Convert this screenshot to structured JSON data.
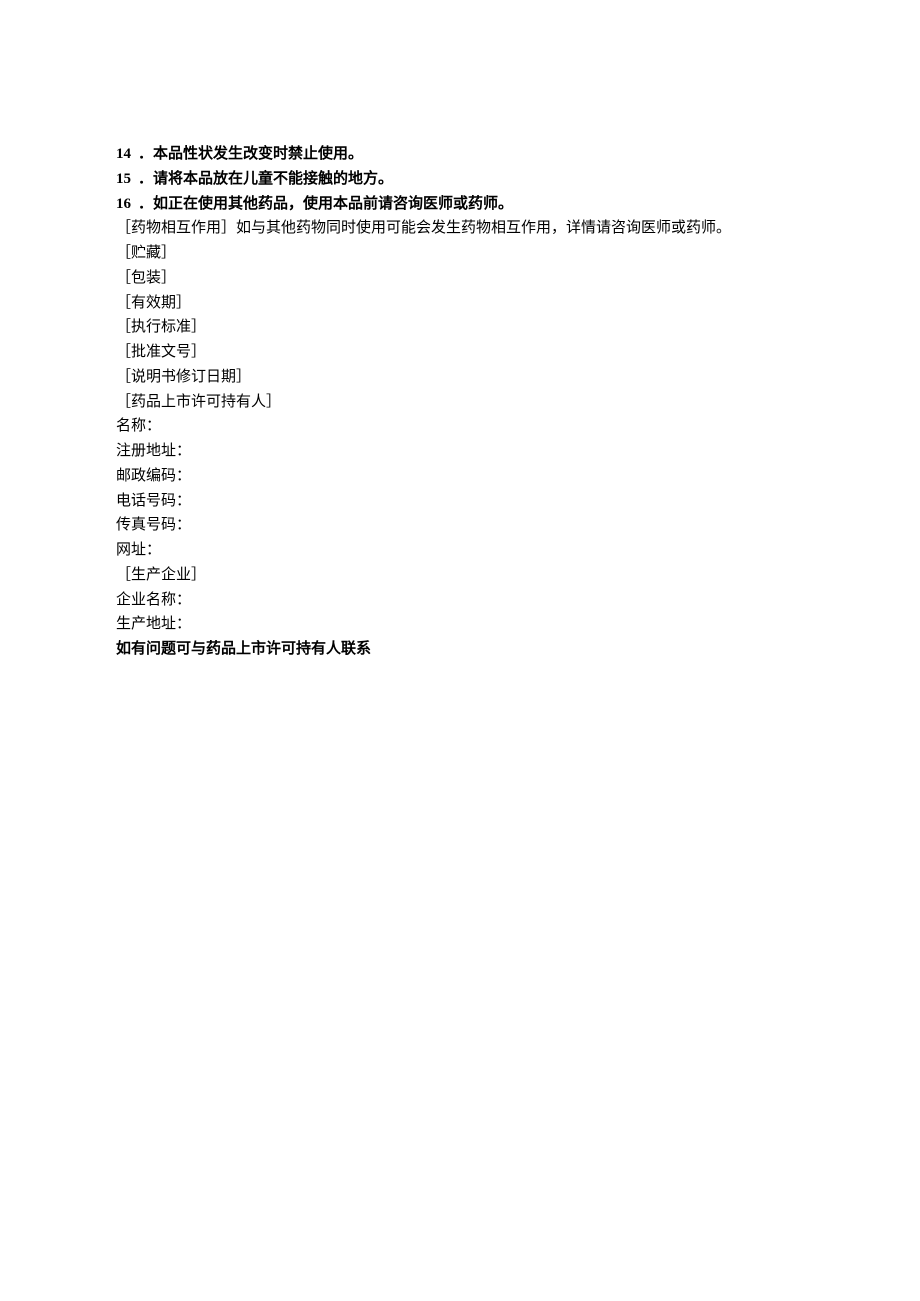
{
  "items": [
    {
      "num": "14",
      "text": "．本品性状发生改变时禁止使用。"
    },
    {
      "num": "15",
      "text": "．请将本品放在儿童不能接触的地方。"
    },
    {
      "num": "16",
      "text": "．如正在使用其他药品，使用本品前请咨询医师或药师。"
    }
  ],
  "interaction": "［药物相互作用］如与其他药物同时使用可能会发生药物相互作用，详情请咨询医师或药师。",
  "sections": [
    "［贮藏］",
    "［包装］",
    "［有效期］",
    "［执行标准］",
    "［批准文号］",
    "［说明书修订日期］",
    "［药品上市许可持有人］"
  ],
  "holder_fields": [
    "名称：",
    "注册地址：",
    "邮政编码：",
    "电话号码：",
    "传真号码：",
    "网址："
  ],
  "manufacturer_header": "［生产企业］",
  "manufacturer_fields": [
    "企业名称：",
    "生产地址："
  ],
  "footer_note": "如有问题可与药品上市许可持有人联系"
}
